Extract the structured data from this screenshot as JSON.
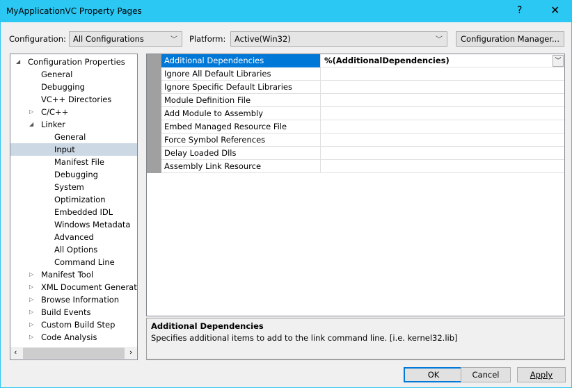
{
  "window": {
    "title": "MyApplicationVC Property Pages",
    "help": "?",
    "close": "✕"
  },
  "config": {
    "label": "Configuration:",
    "value": "All Configurations",
    "platform_label": "Platform:",
    "platform_value": "Active(Win32)",
    "manager_button": "Configuration Manager..."
  },
  "tree": [
    {
      "label": "Configuration Properties",
      "level": 0,
      "glyph": "◢"
    },
    {
      "label": "General",
      "level": 1,
      "glyph": ""
    },
    {
      "label": "Debugging",
      "level": 1,
      "glyph": ""
    },
    {
      "label": "VC++ Directories",
      "level": 1,
      "glyph": ""
    },
    {
      "label": "C/C++",
      "level": 1,
      "glyph": "▷"
    },
    {
      "label": "Linker",
      "level": 1,
      "glyph": "◢"
    },
    {
      "label": "General",
      "level": 2,
      "glyph": ""
    },
    {
      "label": "Input",
      "level": 2,
      "glyph": "",
      "selected": true
    },
    {
      "label": "Manifest File",
      "level": 2,
      "glyph": ""
    },
    {
      "label": "Debugging",
      "level": 2,
      "glyph": ""
    },
    {
      "label": "System",
      "level": 2,
      "glyph": ""
    },
    {
      "label": "Optimization",
      "level": 2,
      "glyph": ""
    },
    {
      "label": "Embedded IDL",
      "level": 2,
      "glyph": ""
    },
    {
      "label": "Windows Metadata",
      "level": 2,
      "glyph": ""
    },
    {
      "label": "Advanced",
      "level": 2,
      "glyph": ""
    },
    {
      "label": "All Options",
      "level": 2,
      "glyph": ""
    },
    {
      "label": "Command Line",
      "level": 2,
      "glyph": ""
    },
    {
      "label": "Manifest Tool",
      "level": 1,
      "glyph": "▷"
    },
    {
      "label": "XML Document Generator",
      "level": 1,
      "glyph": "▷"
    },
    {
      "label": "Browse Information",
      "level": 1,
      "glyph": "▷"
    },
    {
      "label": "Build Events",
      "level": 1,
      "glyph": "▷"
    },
    {
      "label": "Custom Build Step",
      "level": 1,
      "glyph": "▷"
    },
    {
      "label": "Code Analysis",
      "level": 1,
      "glyph": "▷"
    }
  ],
  "properties": [
    {
      "name": "Additional Dependencies",
      "value": "%(AdditionalDependencies)",
      "active": true
    },
    {
      "name": "Ignore All Default Libraries",
      "value": ""
    },
    {
      "name": "Ignore Specific Default Libraries",
      "value": ""
    },
    {
      "name": "Module Definition File",
      "value": ""
    },
    {
      "name": "Add Module to Assembly",
      "value": ""
    },
    {
      "name": "Embed Managed Resource File",
      "value": ""
    },
    {
      "name": "Force Symbol References",
      "value": ""
    },
    {
      "name": "Delay Loaded Dlls",
      "value": ""
    },
    {
      "name": "Assembly Link Resource",
      "value": ""
    }
  ],
  "description": {
    "title": "Additional Dependencies",
    "text": "Specifies additional items to add to the link command line. [i.e. kernel32.lib]"
  },
  "buttons": {
    "ok": "OK",
    "cancel": "Cancel",
    "apply": "Apply"
  },
  "colors": {
    "titlebar": "#2bc8f4",
    "selection": "#0078d7"
  }
}
